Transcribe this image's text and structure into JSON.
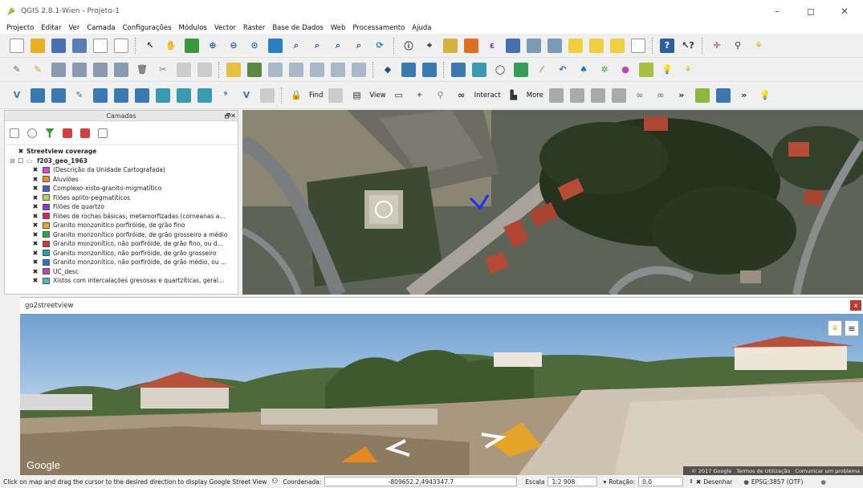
{
  "window": {
    "title": "QGIS 2.8.1-Wien - Projeto-1",
    "minimize": "–",
    "maximize": "◻",
    "close": "✕"
  },
  "menu": [
    "Projecto",
    "Editar",
    "Ver",
    "Camada",
    "Configurações",
    "Módulos",
    "Vector",
    "Raster",
    "Base de Dados",
    "Web",
    "Processamento",
    "Ajuda"
  ],
  "toolbar3": {
    "find_label": "Find",
    "view_label": "View",
    "interact_label": "Interact",
    "more_label": "More"
  },
  "layers_panel": {
    "title": "Camadas",
    "close_glyph": "🗗✕",
    "tree": [
      {
        "label": "Streetview coverage",
        "checked": true,
        "bold": true,
        "level": 0,
        "swatch": ""
      },
      {
        "label": "f203_geo_1963",
        "checked": false,
        "bold": true,
        "level": 0,
        "swatch": ""
      },
      {
        "label": "(Descrição da Unidade Cartografada)",
        "checked": true,
        "bold": false,
        "level": 1,
        "swatch": "#e040e0"
      },
      {
        "label": "Aluviões",
        "checked": true,
        "bold": false,
        "level": 1,
        "swatch": "#f08a24"
      },
      {
        "label": "Complexo-xisto-granito-migmatítico",
        "checked": true,
        "bold": false,
        "level": 1,
        "swatch": "#3a5fcd"
      },
      {
        "label": "Filões aplito-pegmatíticos",
        "checked": true,
        "bold": false,
        "level": 1,
        "swatch": "#b0e040"
      },
      {
        "label": "Filões de quartzo",
        "checked": true,
        "bold": false,
        "level": 1,
        "swatch": "#9b30d0"
      },
      {
        "label": "Filões de rochas básicas, metamorfizadas (corneanas a...",
        "checked": true,
        "bold": false,
        "level": 1,
        "swatch": "#e0206a"
      },
      {
        "label": "Granito monzonítico porfiróide, de grão fino",
        "checked": true,
        "bold": false,
        "level": 1,
        "swatch": "#f0a030"
      },
      {
        "label": "Granito monzonítico porfiróide, de grão grosseiro a médio",
        "checked": true,
        "bold": false,
        "level": 1,
        "swatch": "#20b040"
      },
      {
        "label": "Granito monzonítico, não porfiróide, de grão fino, ou d...",
        "checked": true,
        "bold": false,
        "level": 1,
        "swatch": "#e03030"
      },
      {
        "label": "Granito monzonítico, não porfiróide, de grão grosseiro",
        "checked": true,
        "bold": false,
        "level": 1,
        "swatch": "#10b0a0"
      },
      {
        "label": "Granito monzonítico, não porfiróide, de grão médio, ou ...",
        "checked": true,
        "bold": false,
        "level": 1,
        "swatch": "#2070e0"
      },
      {
        "label": "UC_desc",
        "checked": true,
        "bold": false,
        "level": 1,
        "swatch": "#c040c0"
      },
      {
        "label": "Xistos com intercalações gresosas e quartzíticas, geral...",
        "checked": true,
        "bold": false,
        "level": 1,
        "swatch": "#40c0d0"
      }
    ]
  },
  "streetview": {
    "title": "go2streetview",
    "close_glyph": "x",
    "google_logo": "Google",
    "attribution": "© 2017 Google",
    "terms": "Termos de Utilização",
    "report": "Comunicar um problema",
    "menu_glyph": "≡"
  },
  "status": {
    "hint": "Click on map and drag the cursor to the desired direction to display Google Street View",
    "coord_label": "Coordenada:",
    "coord_value": "-809652.2,4943347.7",
    "scale_label": "Escala",
    "scale_value": "1:2 908",
    "rotation_label": "Rotação:",
    "rotation_value": "0,0",
    "render_label": "Desenhar",
    "crs_label": "EPSG:3857 (OTF)"
  }
}
